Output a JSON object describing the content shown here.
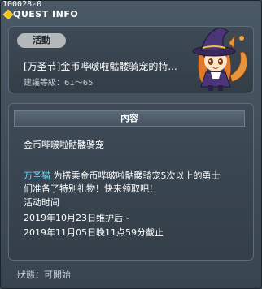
{
  "window": {
    "id_label": "100028-0",
    "title": "QUEST INFO"
  },
  "quest": {
    "category_pill": "活動",
    "name": "[万圣节]金币哔啵啦骷髅骑宠的特...",
    "recommend_level": "建議等級：61～65"
  },
  "content": {
    "header": "內容",
    "reward_name": "金币哔啵啦骷髅骑宠",
    "npc_name": "万圣猫",
    "desc_line1": " 为搭乘金币哔啵啦骷髅骑宠5次以上的勇士",
    "desc_line2": "们准备了特别礼物！快来领取吧！",
    "time_label": "活动时间",
    "time_start": "2019年10月23日维护后~",
    "time_end": "2019年11月05日晚11点59分截止"
  },
  "status": "狀態：可開始",
  "colors": {
    "npc_name": "#6fd8ff",
    "pill_bg": "#b5b8bb",
    "panel_bg": "#3e4b56"
  }
}
